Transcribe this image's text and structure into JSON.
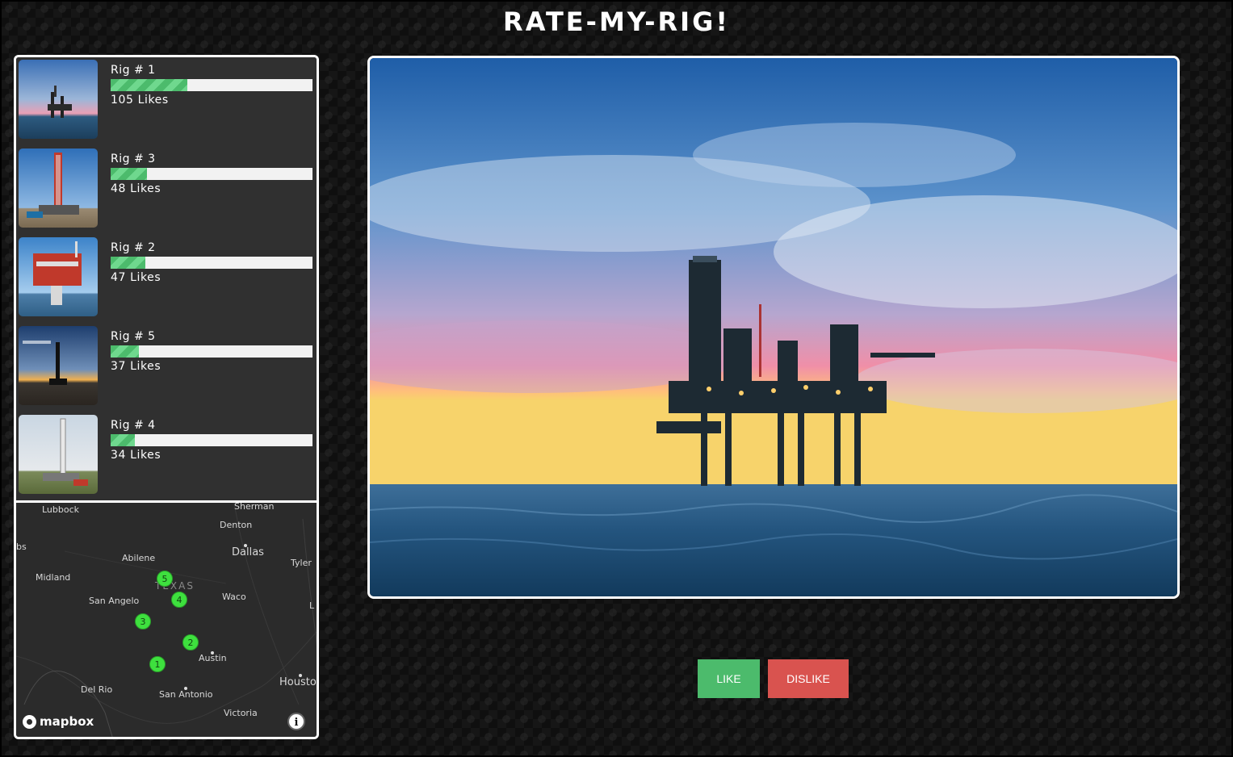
{
  "header": {
    "title": "RATE-MY-RIG!"
  },
  "rigs": [
    {
      "name": "Rig # 1",
      "likes": "105 Likes",
      "like_fraction": 0.38
    },
    {
      "name": "Rig # 3",
      "likes": "48 Likes",
      "like_fraction": 0.18
    },
    {
      "name": "Rig # 2",
      "likes": "47 Likes",
      "like_fraction": 0.17
    },
    {
      "name": "Rig # 5",
      "likes": "37 Likes",
      "like_fraction": 0.14
    },
    {
      "name": "Rig # 4",
      "likes": "34 Likes",
      "like_fraction": 0.12
    }
  ],
  "map": {
    "cities": {
      "lubbock": "Lubbock",
      "sherman": "Sherman",
      "denton": "Denton",
      "dallas": "Dallas",
      "tyler": "Tyler",
      "abilene": "Abilene",
      "midland": "Midland",
      "texas": "TEXAS",
      "san_angelo": "San Angelo",
      "waco": "Waco",
      "austin": "Austin",
      "del_rio": "Del Rio",
      "san_antonio": "San Antonio",
      "houston": "Housto",
      "victoria": "Victoria",
      "edge_bs": "bs",
      "edge_l": "L"
    },
    "markers": [
      "5",
      "4",
      "3",
      "2",
      "1"
    ],
    "attribution": "mapbox",
    "info": "i"
  },
  "actions": {
    "like_label": "LIKE",
    "dislike_label": "DISLIKE"
  },
  "colors": {
    "like": "#4cbb6c",
    "dislike": "#d9534f",
    "marker": "#3ee03e"
  }
}
